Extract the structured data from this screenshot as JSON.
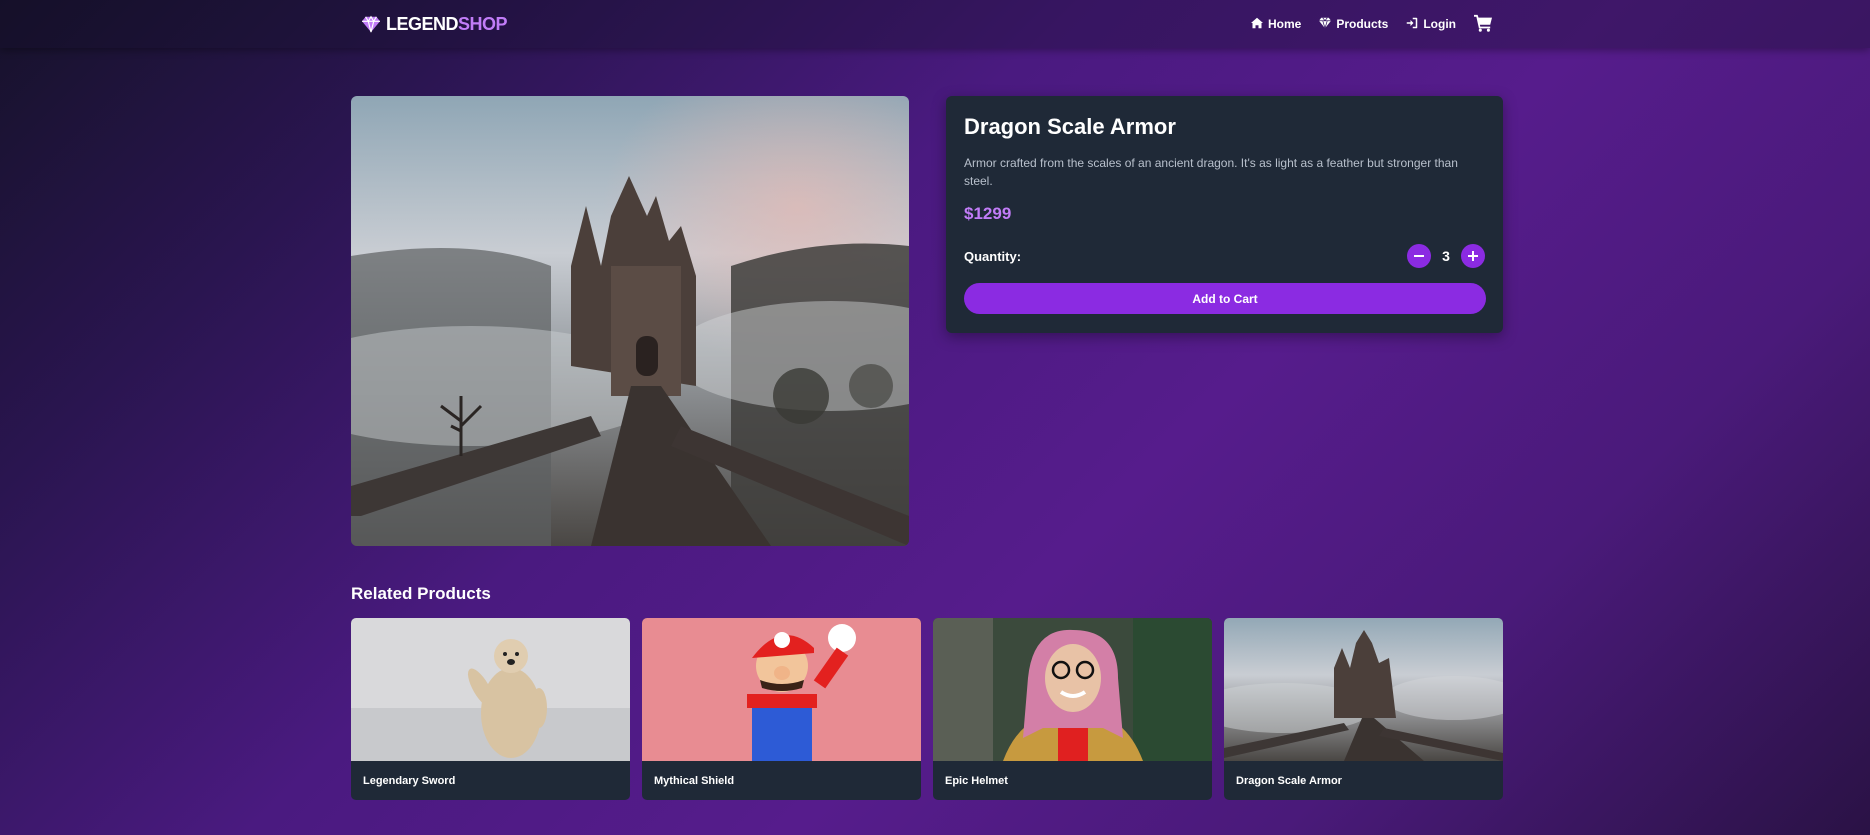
{
  "header": {
    "logo_part1": "LEGEND",
    "logo_part2": "SHOP",
    "nav": [
      {
        "label": "Home",
        "icon": "home-icon"
      },
      {
        "label": "Products",
        "icon": "gem-icon"
      },
      {
        "label": "Login",
        "icon": "login-icon"
      }
    ],
    "cart_icon": "cart-icon"
  },
  "product": {
    "title": "Dragon Scale Armor",
    "description": "Armor crafted from the scales of an ancient dragon. It's as light as a feather but stronger than steel.",
    "price": "$1299",
    "quantity_label": "Quantity:",
    "quantity": "3",
    "add_to_cart": "Add to Cart"
  },
  "related": {
    "title": "Related Products",
    "items": [
      {
        "name": "Legendary Sword"
      },
      {
        "name": "Mythical Shield"
      },
      {
        "name": "Epic Helmet"
      },
      {
        "name": "Dragon Scale Armor"
      }
    ]
  },
  "colors": {
    "accent": "#8b2be2",
    "price": "#c17cf7",
    "panel": "#1f2937"
  }
}
